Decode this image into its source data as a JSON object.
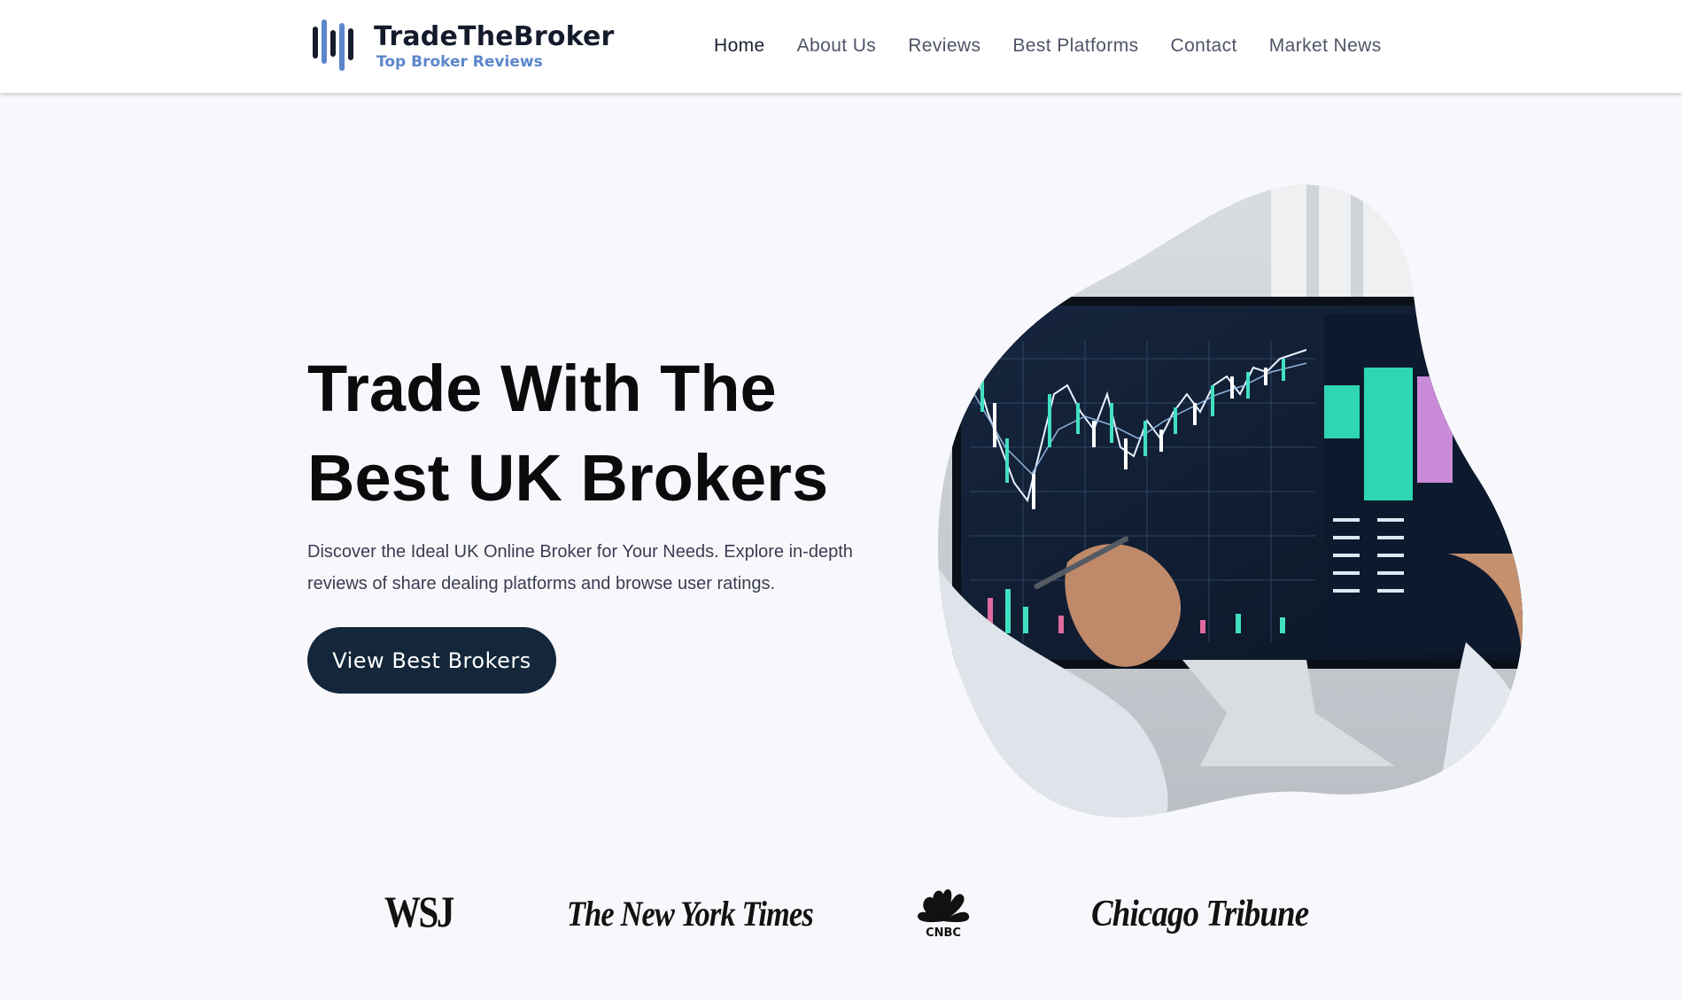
{
  "brand": {
    "name": "TradeTheBroker",
    "tagline": "Top Broker Reviews",
    "colors": {
      "dark": "#141c2c",
      "accent": "#5c86cc",
      "button": "#13263a"
    }
  },
  "nav": {
    "items": [
      {
        "label": "Home"
      },
      {
        "label": "About Us"
      },
      {
        "label": "Reviews"
      },
      {
        "label": "Best Platforms"
      },
      {
        "label": "Contact"
      },
      {
        "label": "Market News"
      }
    ]
  },
  "hero": {
    "title_line1": "Trade With The",
    "title_line2": "Best UK Brokers",
    "description": "Discover the Ideal UK Online Broker for Your Needs. Explore in-depth reviews of share dealing platforms and browse user ratings.",
    "cta_label": "View Best Brokers",
    "image_icon": "trading-screen-photo"
  },
  "press": {
    "logos": [
      {
        "name": "WSJ"
      },
      {
        "name": "The New York Times"
      },
      {
        "name": "CNBC"
      },
      {
        "name": "Chicago Tribune"
      }
    ]
  }
}
